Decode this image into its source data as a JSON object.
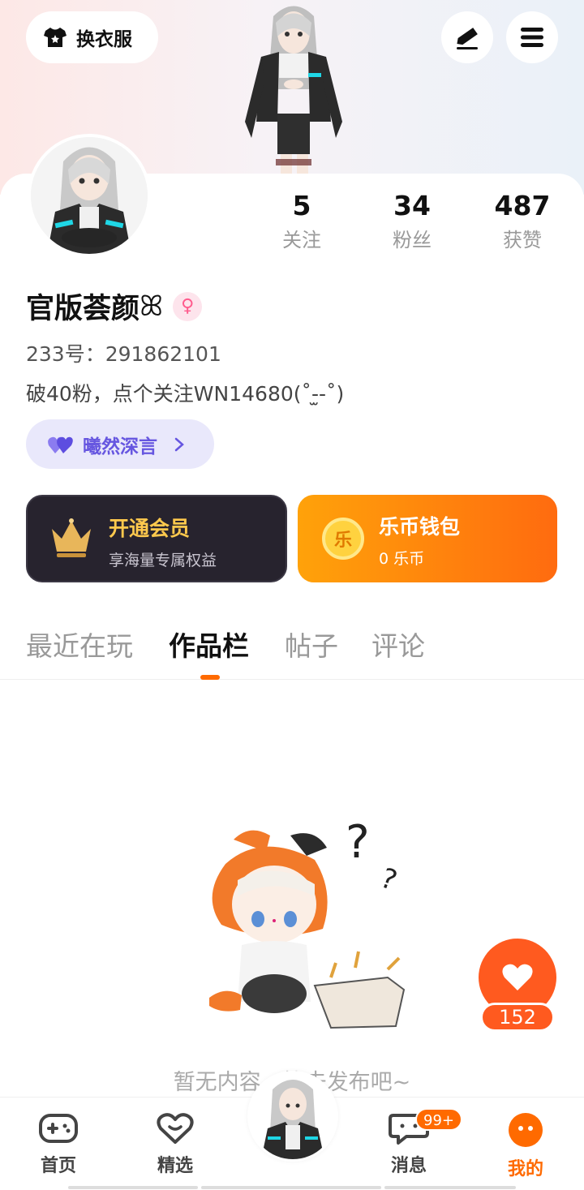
{
  "header": {
    "outfit_label": "换衣服",
    "icons": [
      "tshirt-icon",
      "edit-icon",
      "menu-icon"
    ]
  },
  "stats": [
    {
      "value": "5",
      "label": "关注"
    },
    {
      "value": "34",
      "label": "粉丝"
    },
    {
      "value": "487",
      "label": "获赞"
    }
  ],
  "profile": {
    "username": "官版荟颜",
    "username_decoration": "ꕤ",
    "gender_symbol": "♀",
    "uid": "233号：291862101",
    "bio": "破40粉，点个关注WN14680(˚-̫-˚)",
    "tag_label": "曦然深言"
  },
  "cards": {
    "vip_title": "开通会员",
    "vip_sub": "享海量专属权益",
    "wallet_title": "乐币钱包",
    "wallet_sub": "0 乐币",
    "coin_char": "乐"
  },
  "tabs": [
    "最近在玩",
    "作品栏",
    "帖子",
    "评论"
  ],
  "active_tab": "作品栏",
  "empty_text": "暂无内容，快去发布吧~",
  "like_count": "152",
  "nav": {
    "items": [
      "首页",
      "精选",
      "消息",
      "我的"
    ],
    "msg_badge": "99+"
  },
  "colors": {
    "accent": "#ff6a00",
    "tag_purple": "#6656e0",
    "vip_gold": "#ffc94d"
  }
}
